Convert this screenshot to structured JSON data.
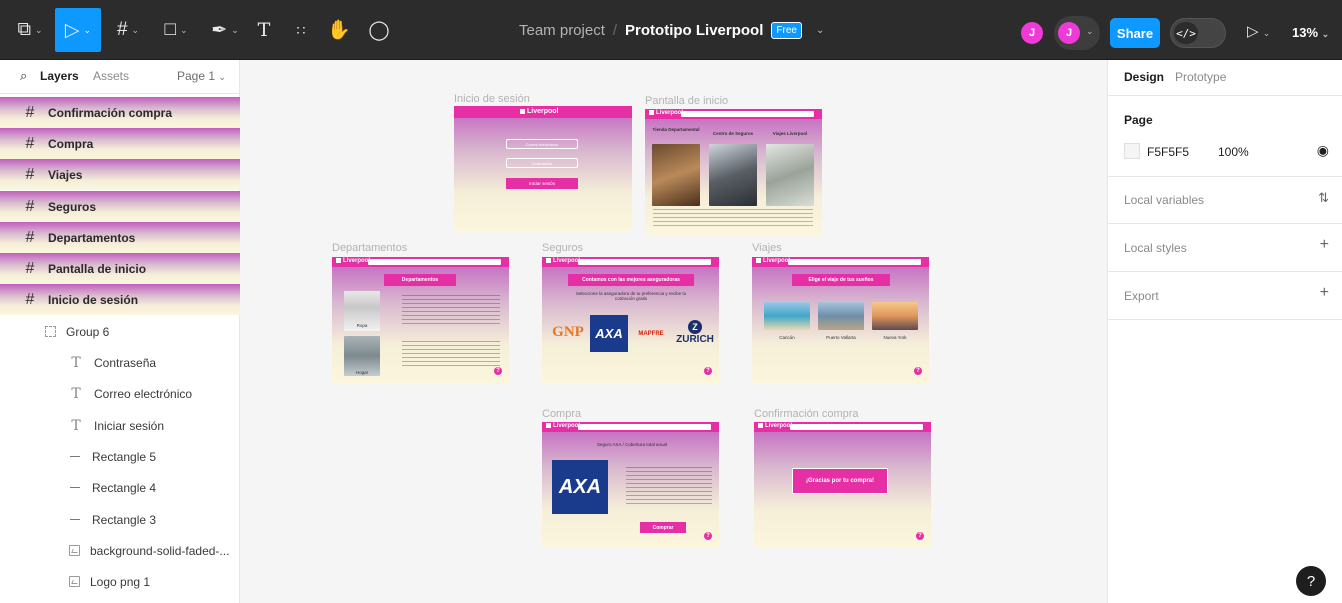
{
  "toolbar": {
    "tools": [
      "main-menu",
      "move",
      "frame",
      "shape",
      "pen",
      "text",
      "resources",
      "hand",
      "comment"
    ],
    "team": "Team project",
    "separator": "/",
    "project": "Prototipo Liverpool",
    "plan_badge": "Free",
    "avatar_initial": "J",
    "share_label": "Share",
    "dev_mode_label": "</>",
    "zoom": "13%"
  },
  "left_panel": {
    "tabs": {
      "layers": "Layers",
      "assets": "Assets",
      "page": "Page 1"
    },
    "layers": [
      {
        "label": "Confirmación compra",
        "kind": "frame"
      },
      {
        "label": "Compra",
        "kind": "frame"
      },
      {
        "label": "Viajes",
        "kind": "frame"
      },
      {
        "label": "Seguros",
        "kind": "frame"
      },
      {
        "label": "Departamentos",
        "kind": "frame"
      },
      {
        "label": "Pantalla de inicio",
        "kind": "frame"
      },
      {
        "label": "Inicio de sesión",
        "kind": "frame"
      },
      {
        "label": "Group 6",
        "kind": "group"
      },
      {
        "label": "Contraseña",
        "kind": "text"
      },
      {
        "label": "Correo electrónico",
        "kind": "text"
      },
      {
        "label": "Iniciar sesión",
        "kind": "text"
      },
      {
        "label": "Rectangle 5",
        "kind": "rect"
      },
      {
        "label": "Rectangle 4",
        "kind": "rect"
      },
      {
        "label": "Rectangle 3",
        "kind": "rect"
      },
      {
        "label": "background-solid-faded-...",
        "kind": "image"
      },
      {
        "label": "Logo png 1",
        "kind": "image"
      }
    ]
  },
  "canvas": {
    "frames": {
      "inicio": {
        "title": "Inicio de sesión",
        "logo": "Liverpool",
        "email_placeholder": "Correo electrónico",
        "password_placeholder": "Contraseña",
        "login_button": "Iniciar sesión"
      },
      "pantalla": {
        "title": "Pantalla de inicio",
        "logo": "Liverpool",
        "col1": "Tienda Departamental",
        "col2": "Centro de Seguros",
        "col3": "Viajes Liverpool"
      },
      "departamentos": {
        "title": "Departamentos",
        "logo": "Liverpool",
        "heading": "Departamentos",
        "cap1": "Ropa",
        "cap2": "Hogar"
      },
      "seguros": {
        "title": "Seguros",
        "logo": "Liverpool",
        "heading": "Contamos con las mejores aseguradoras",
        "sub": "Seleccione la aseguradora de tu preferencia y recibe tu cotización gratis",
        "insurers": [
          "GNP",
          "AXA",
          "MAPFRE",
          "ZURICH"
        ]
      },
      "viajes": {
        "title": "Viajes",
        "logo": "Liverpool",
        "heading": "Elige el viaje de tus sueños",
        "dests": [
          "Cancún",
          "Puerto Vallarta",
          "Nueva York"
        ]
      },
      "compra": {
        "title": "Compra",
        "logo": "Liverpool",
        "line": "Seguro AXA / Cobertura total anual",
        "buy_button": "Comprar",
        "brand": "AXA"
      },
      "confirmacion": {
        "title": "Confirmación compra",
        "logo": "Liverpool",
        "thanks": "¡Gracias por tu compra!"
      }
    }
  },
  "right_panel": {
    "tabs": {
      "design": "Design",
      "prototype": "Prototype"
    },
    "page_label": "Page",
    "page_color": "F5F5F5",
    "page_opacity": "100%",
    "local_variables": "Local variables",
    "local_styles": "Local styles",
    "export": "Export"
  },
  "help_label": "?",
  "colors": {
    "accent": "#0d99ff",
    "brand_pink": "#e62ea5",
    "toolbar_bg": "#2c2c2c",
    "canvas_bg": "#f5f5f5"
  }
}
